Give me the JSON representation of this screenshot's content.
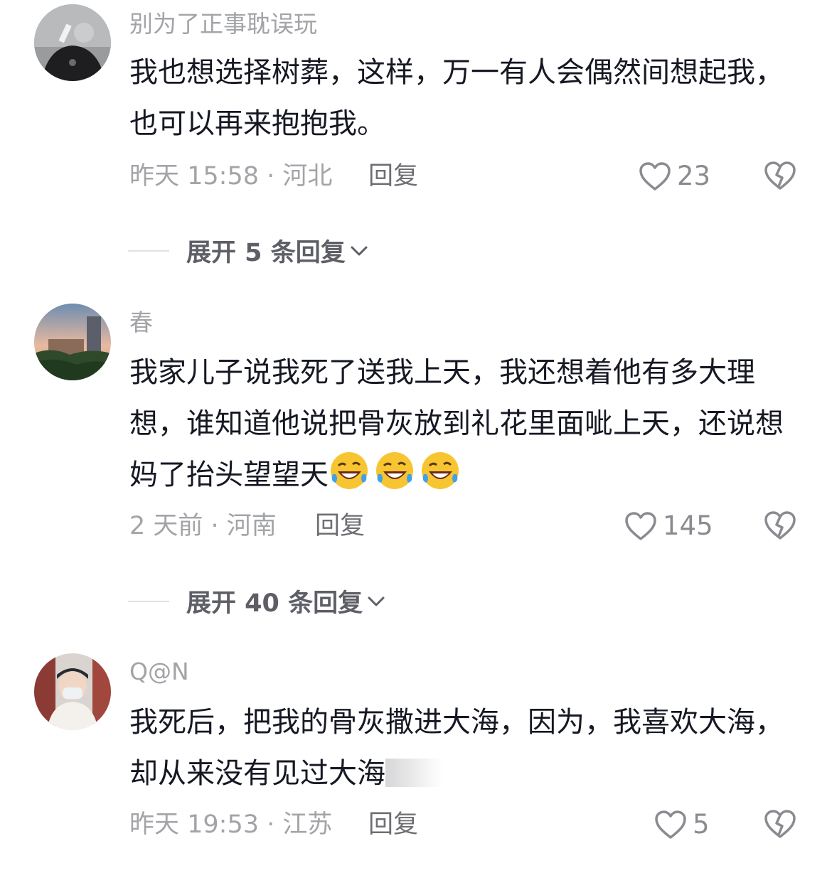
{
  "comments": [
    {
      "author": "别为了正事耽误玩",
      "text": "我也想选择树葬，这样，万一有人会偶然间想起我，也可以再来抱抱我。",
      "meta": "昨天 15:58 · 河北",
      "reply_label": "回复",
      "likes": "23",
      "expand_label": "展开 5 条回复"
    },
    {
      "author": "春",
      "text": "我家儿子说我死了送我上天，我还想着他有多大理想，谁知道他说把骨灰放到礼花里面呲上天，还说想妈了抬头望望天",
      "emojis": [
        "rofl-emoji",
        "rofl-emoji",
        "rofl-emoji"
      ],
      "meta": "2 天前 · 河南",
      "reply_label": "回复",
      "likes": "145",
      "expand_label": "展开 40 条回复"
    },
    {
      "author": "Q@N",
      "text": "我死后，把我的骨灰撒进大海，因为，我喜欢大海，却从来没有见过大海",
      "meta": "昨天 19:53 · 江苏",
      "reply_label": "回复",
      "likes": "5"
    }
  ],
  "icons": {
    "like": "heart-outline-icon",
    "dislike": "broken-heart-icon",
    "expand": "chevron-down-icon"
  },
  "colors": {
    "text": "#161823",
    "secondary": "#a3a4a8",
    "reply": "#6d6e73"
  }
}
